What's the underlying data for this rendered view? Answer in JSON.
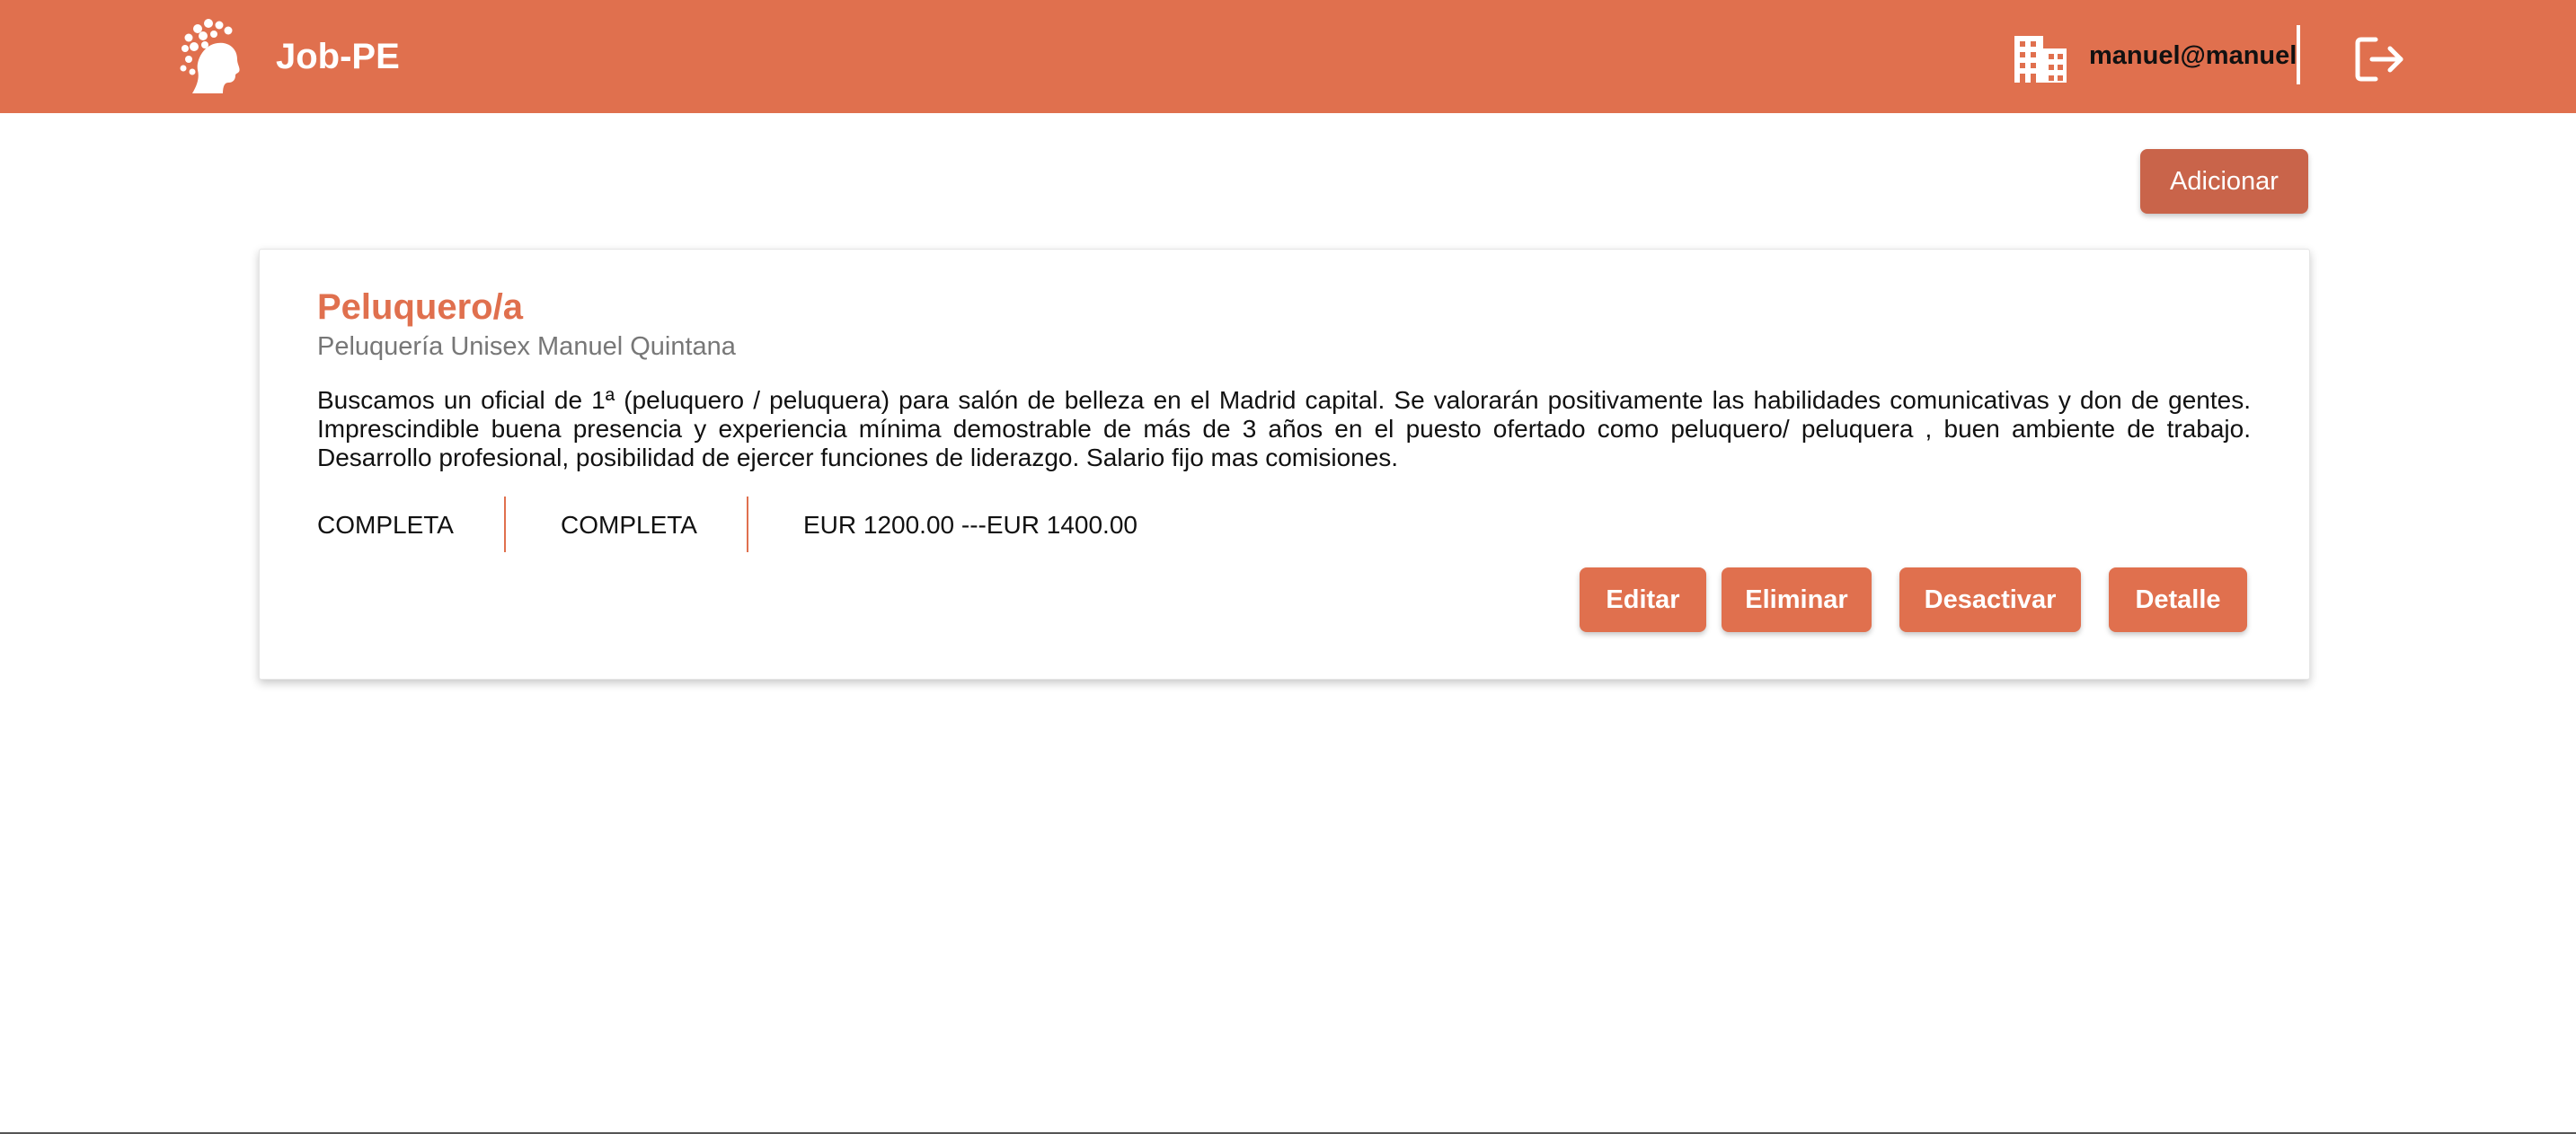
{
  "header": {
    "brand": "Job-PE",
    "user_email": "manuel@manuel",
    "logo_icon": "woman-tree-logo",
    "company_icon": "building-icon",
    "logout_icon": "logout-icon",
    "bg_color": "#e0704e"
  },
  "toolbar": {
    "add_label": "Adicionar"
  },
  "job": {
    "title": "Peluquero/a",
    "company": "Peluquería Unisex Manuel Quintana",
    "description": "Buscamos un oficial de 1ª (peluquero / peluquera) para salón de belleza en el Madrid capital. Se valorarán positivamente las habilidades comunicativas y don de gentes. Imprescindible buena presencia y experiencia mínima demostrable de más de 3 años en el puesto ofertado como peluquero/ peluquera , buen ambiente de trabajo. Desarrollo profesional, posibilidad de ejercer funciones de liderazgo. Salario fijo mas comisiones.",
    "meta": [
      "COMPLETA",
      "COMPLETA",
      "EUR 1200.00 ---EUR 1400.00"
    ],
    "actions": {
      "edit": "Editar",
      "delete": "Eliminar",
      "deactivate": "Desactivar",
      "detail": "Detalle"
    }
  },
  "colors": {
    "accent": "#e0704e",
    "add_button": "#c9644a"
  }
}
